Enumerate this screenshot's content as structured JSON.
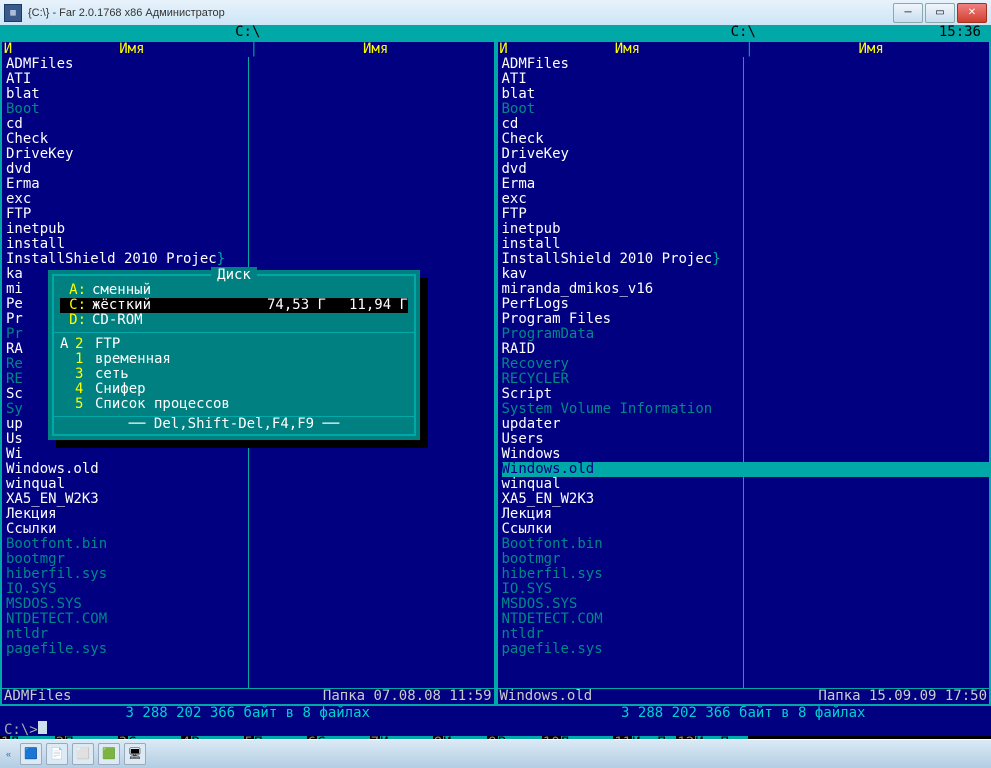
{
  "window": {
    "title": "{C:\\} - Far 2.0.1768 x86 Администратор"
  },
  "clock": "15:36",
  "path": {
    "left": "C:\\",
    "right": "C:\\"
  },
  "column_headers": {
    "i": "И",
    "name": "Имя"
  },
  "left_files": [
    {
      "n": "ADMFiles",
      "h": false
    },
    {
      "n": "ATI",
      "h": false
    },
    {
      "n": "blat",
      "h": false
    },
    {
      "n": "Boot",
      "h": true
    },
    {
      "n": "cd",
      "h": false
    },
    {
      "n": "Check",
      "h": false
    },
    {
      "n": "DriveKey",
      "h": false
    },
    {
      "n": "dvd",
      "h": false
    },
    {
      "n": "Erma",
      "h": false
    },
    {
      "n": "exc",
      "h": false
    },
    {
      "n": "FTP",
      "h": false
    },
    {
      "n": "inetpub",
      "h": false
    },
    {
      "n": "install",
      "h": false
    },
    {
      "n": "InstallShield 2010 Projec",
      "h": false,
      "trunc": true
    },
    {
      "n": "ka",
      "h": false
    },
    {
      "n": "mi",
      "h": false
    },
    {
      "n": "Pe",
      "h": false
    },
    {
      "n": "Pr",
      "h": false
    },
    {
      "n": "Pr",
      "h": true
    },
    {
      "n": "RA",
      "h": false
    },
    {
      "n": "Re",
      "h": true
    },
    {
      "n": "RE",
      "h": true
    },
    {
      "n": "Sc",
      "h": false
    },
    {
      "n": "Sy",
      "h": true
    },
    {
      "n": "up",
      "h": false
    },
    {
      "n": "Us",
      "h": false
    },
    {
      "n": "Wi",
      "h": false
    },
    {
      "n": "Windows.old",
      "h": false
    },
    {
      "n": "winqual",
      "h": false
    },
    {
      "n": "XA5_EN_W2K3",
      "h": false
    },
    {
      "n": "Лекция",
      "h": false
    },
    {
      "n": "Ссылки",
      "h": false
    },
    {
      "n": "Bootfont.bin",
      "h": true
    },
    {
      "n": "bootmgr",
      "h": true
    },
    {
      "n": "hiberfil.sys",
      "h": true
    },
    {
      "n": "IO.SYS",
      "h": true
    },
    {
      "n": "MSDOS.SYS",
      "h": true
    },
    {
      "n": "NTDETECT.COM",
      "h": true
    },
    {
      "n": "ntldr",
      "h": true
    },
    {
      "n": "pagefile.sys",
      "h": true
    }
  ],
  "right_files": [
    {
      "n": "ADMFiles",
      "h": false
    },
    {
      "n": "ATI",
      "h": false
    },
    {
      "n": "blat",
      "h": false
    },
    {
      "n": "Boot",
      "h": true
    },
    {
      "n": "cd",
      "h": false
    },
    {
      "n": "Check",
      "h": false
    },
    {
      "n": "DriveKey",
      "h": false
    },
    {
      "n": "dvd",
      "h": false
    },
    {
      "n": "Erma",
      "h": false
    },
    {
      "n": "exc",
      "h": false
    },
    {
      "n": "FTP",
      "h": false
    },
    {
      "n": "inetpub",
      "h": false
    },
    {
      "n": "install",
      "h": false
    },
    {
      "n": "InstallShield 2010 Projec",
      "h": false,
      "trunc": true
    },
    {
      "n": "kav",
      "h": false
    },
    {
      "n": "miranda_dmikos_v16",
      "h": false
    },
    {
      "n": "PerfLogs",
      "h": false
    },
    {
      "n": "Program Files",
      "h": false
    },
    {
      "n": "ProgramData",
      "h": true
    },
    {
      "n": "RAID",
      "h": false
    },
    {
      "n": "Recovery",
      "h": true
    },
    {
      "n": "RECYCLER",
      "h": true
    },
    {
      "n": "Script",
      "h": false
    },
    {
      "n": "System Volume Information",
      "h": true
    },
    {
      "n": "updater",
      "h": false
    },
    {
      "n": "Users",
      "h": false
    },
    {
      "n": "Windows",
      "h": false
    },
    {
      "n": "Windows.old",
      "h": false,
      "sel": true
    },
    {
      "n": "winqual",
      "h": false
    },
    {
      "n": "XA5_EN_W2K3",
      "h": false
    },
    {
      "n": "Лекция",
      "h": false
    },
    {
      "n": "Ссылки",
      "h": false
    },
    {
      "n": "Bootfont.bin",
      "h": true
    },
    {
      "n": "bootmgr",
      "h": true
    },
    {
      "n": "hiberfil.sys",
      "h": true
    },
    {
      "n": "IO.SYS",
      "h": true
    },
    {
      "n": "MSDOS.SYS",
      "h": true
    },
    {
      "n": "NTDETECT.COM",
      "h": true
    },
    {
      "n": "ntldr",
      "h": true
    },
    {
      "n": "pagefile.sys",
      "h": true
    }
  ],
  "left_footer": {
    "name": "ADMFiles",
    "info": "Папка 07.08.08 11:59"
  },
  "right_footer": {
    "name": "Windows.old",
    "info": "Папка 15.09.09 17:50"
  },
  "summary": "3 288 202 366 байт в 8 файлах",
  "cmd_prompt": "C:\\>",
  "keybar": [
    {
      "n": "1",
      "l": "Левая "
    },
    {
      "n": "2",
      "l": "Правая"
    },
    {
      "n": "3",
      "l": "Смотр."
    },
    {
      "n": "4",
      "l": "Редак."
    },
    {
      "n": "5",
      "l": "Печать"
    },
    {
      "n": "6",
      "l": "Ссылка"
    },
    {
      "n": "7",
      "l": "Искать"
    },
    {
      "n": "8",
      "l": "Истор "
    },
    {
      "n": "9",
      "l": "Видео "
    },
    {
      "n": "10",
      "l": "Дерево"
    },
    {
      "n": "11",
      "l": "ИстПр "
    },
    {
      "n": "12",
      "l": "ИстПап"
    }
  ],
  "dialog": {
    "title": "Диск",
    "drives": [
      {
        "letter": "A:",
        "desc": "сменный",
        "total": "",
        "free": ""
      },
      {
        "letter": "C:",
        "desc": "жёсткий",
        "total": "74,53 Г",
        "free": "11,94 Г",
        "sel": true
      },
      {
        "letter": "D:",
        "desc": "CD-ROM",
        "total": "",
        "free": ""
      }
    ],
    "extras": [
      {
        "hot": "A",
        "num": "2",
        "label": "FTP"
      },
      {
        "hot": "",
        "num": "1",
        "label": "временная"
      },
      {
        "hot": "",
        "num": "3",
        "label": "сеть"
      },
      {
        "hot": "",
        "num": "4",
        "label": "Снифер"
      },
      {
        "hot": "",
        "num": "5",
        "label": "Список процессов"
      }
    ],
    "hint": "Del,Shift-Del,F4,F9"
  }
}
